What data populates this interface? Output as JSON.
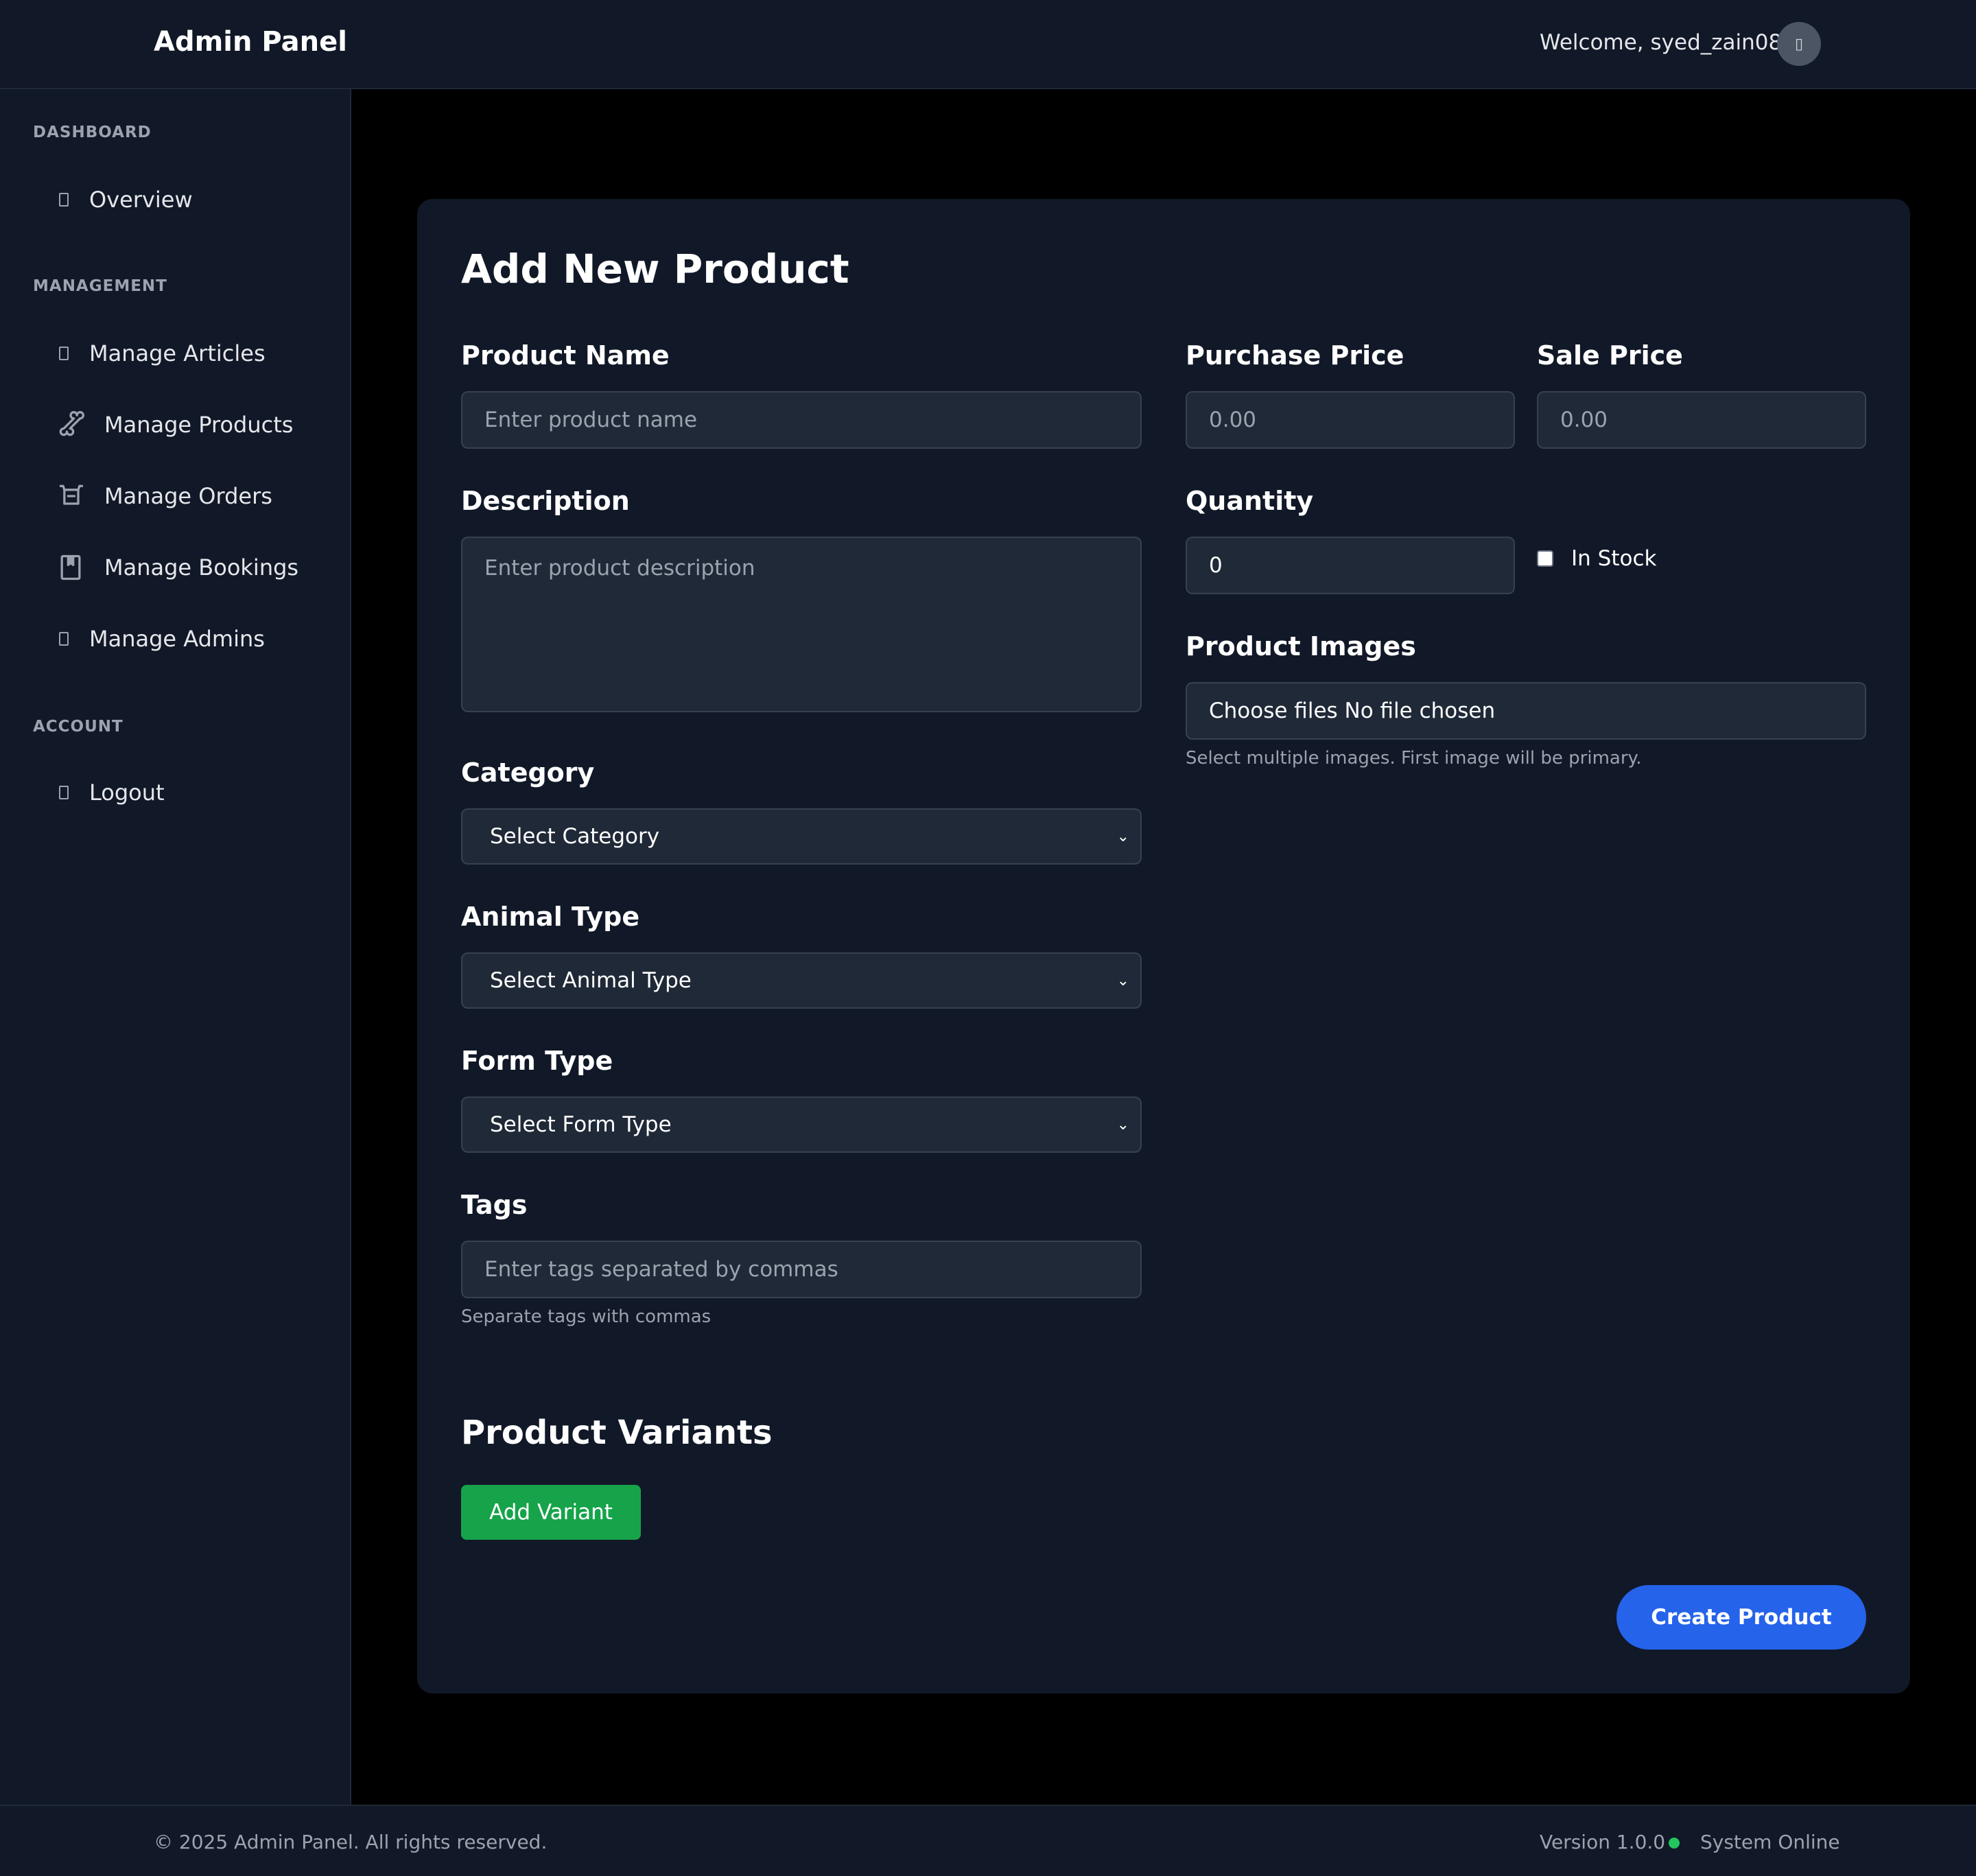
{
  "header": {
    "brand": "Admin Panel",
    "welcome": "Welcome, syed_zain08",
    "avatar_icon": "user-icon"
  },
  "sidebar": {
    "sections": {
      "dashboard": "DASHBOARD",
      "management": "MANAGEMENT",
      "account": "ACCOUNT"
    },
    "items": [
      {
        "label": "Overview",
        "icon": "overview-icon"
      },
      {
        "label": "Manage Articles",
        "icon": "articles-icon"
      },
      {
        "label": "Manage Products",
        "icon": "bone-icon"
      },
      {
        "label": "Manage Orders",
        "icon": "cart-icon"
      },
      {
        "label": "Manage Bookings",
        "icon": "bookmark-icon"
      },
      {
        "label": "Manage Admins",
        "icon": "admins-icon"
      },
      {
        "label": "Logout",
        "icon": "logout-icon"
      }
    ]
  },
  "form": {
    "title": "Add New Product",
    "product_name": {
      "label": "Product Name",
      "placeholder": "Enter product name"
    },
    "purchase_price": {
      "label": "Purchase Price",
      "placeholder": "0.00"
    },
    "sale_price": {
      "label": "Sale Price",
      "placeholder": "0.00"
    },
    "description": {
      "label": "Description",
      "placeholder": "Enter product description"
    },
    "quantity": {
      "label": "Quantity",
      "value": "0"
    },
    "in_stock": {
      "label": "In Stock",
      "checked": false
    },
    "images": {
      "label": "Product Images",
      "file_text": "Choose files No file chosen",
      "hint": "Select multiple images. First image will be primary."
    },
    "category": {
      "label": "Category",
      "selected": "Select Category"
    },
    "animal_type": {
      "label": "Animal Type",
      "selected": "Select Animal Type"
    },
    "form_type": {
      "label": "Form Type",
      "selected": "Select Form Type"
    },
    "tags": {
      "label": "Tags",
      "placeholder": "Enter tags separated by commas",
      "hint": "Separate tags with commas"
    },
    "variants_title": "Product Variants",
    "add_variant": "Add Variant",
    "submit": "Create Product"
  },
  "footer": {
    "copyright": "© 2025 Admin Panel. All rights reserved.",
    "version": "Version 1.0.0",
    "status": "System Online",
    "status_color": "#22c55e"
  },
  "colors": {
    "background": "#000000",
    "surface": "#111827",
    "input": "#1f2937",
    "primary": "#2563eb",
    "success": "#16a34a"
  }
}
